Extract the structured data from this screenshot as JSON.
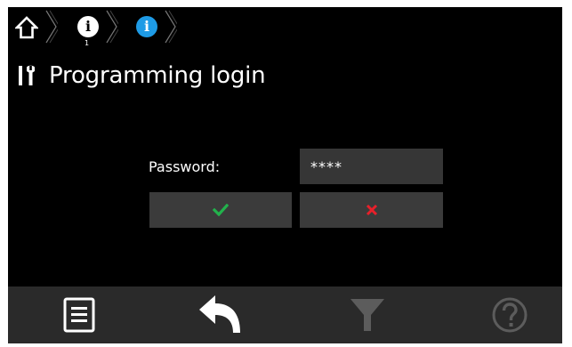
{
  "breadcrumb": {
    "items": [
      {
        "icon": "home-icon"
      },
      {
        "icon": "info-icon",
        "sub_label": "1",
        "color": "#ffffff"
      },
      {
        "icon": "info-icon",
        "color": "#1e9be6"
      }
    ]
  },
  "header": {
    "icon": "tools-icon",
    "title": "Programming login"
  },
  "form": {
    "password_label": "Password:",
    "password_value": "****",
    "confirm_icon": "check-icon",
    "confirm_color": "#22b24c",
    "cancel_icon": "x-icon",
    "cancel_color": "#e8202a"
  },
  "bottom_bar": {
    "items": [
      {
        "icon": "menu-list-icon"
      },
      {
        "icon": "back-arrow-icon"
      },
      {
        "icon": "filter-icon",
        "disabled": true
      },
      {
        "icon": "help-icon",
        "disabled": true
      }
    ]
  },
  "colors": {
    "background": "#000000",
    "panel": "#3b3b3b",
    "bottom_bar": "#2a2a2a",
    "accent": "#1e9be6"
  }
}
